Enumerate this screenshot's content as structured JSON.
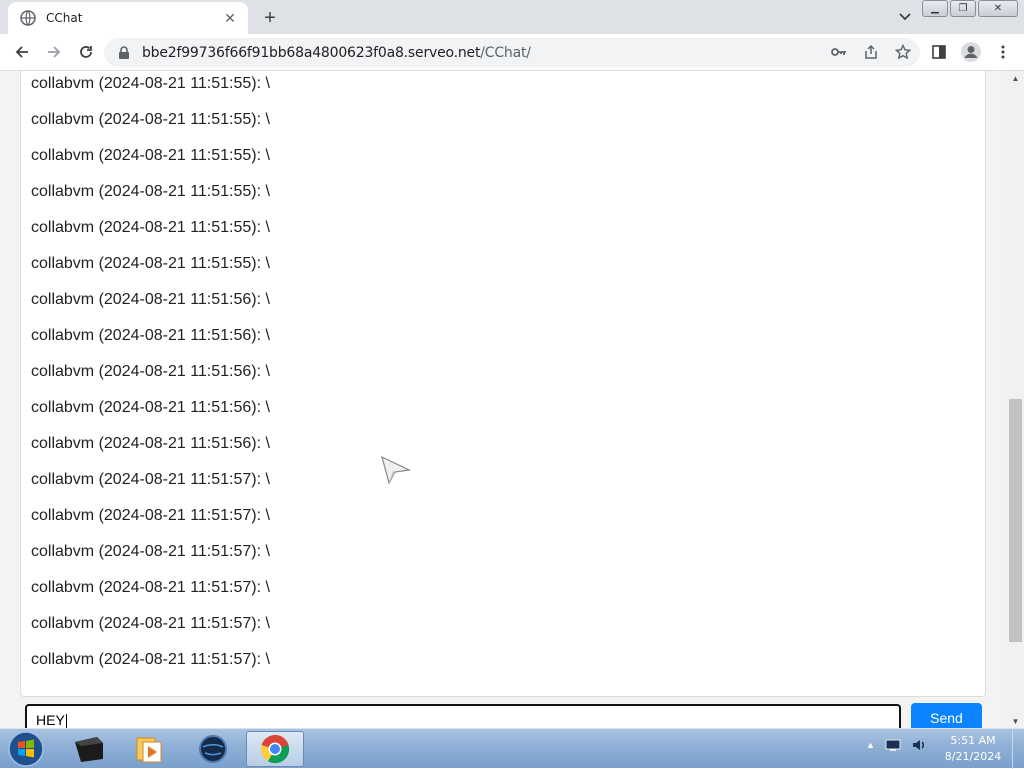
{
  "browser": {
    "tab_title": "CChat",
    "url_host": "bbe2f99736f66f91bb68a4800623f0a8.serveo.net",
    "url_path": "/CChat/"
  },
  "chat": {
    "messages": [
      "collabvm (2024-08-21 11:51:55): \\",
      "collabvm (2024-08-21 11:51:55): \\",
      "collabvm (2024-08-21 11:51:55): \\",
      "collabvm (2024-08-21 11:51:55): \\",
      "collabvm (2024-08-21 11:51:55): \\",
      "collabvm (2024-08-21 11:51:55): \\",
      "collabvm (2024-08-21 11:51:56): \\",
      "collabvm (2024-08-21 11:51:56): \\",
      "collabvm (2024-08-21 11:51:56): \\",
      "collabvm (2024-08-21 11:51:56): \\",
      "collabvm (2024-08-21 11:51:56): \\",
      "collabvm (2024-08-21 11:51:57): \\",
      "collabvm (2024-08-21 11:51:57): \\",
      "collabvm (2024-08-21 11:51:57): \\",
      "collabvm (2024-08-21 11:51:57): \\",
      "collabvm (2024-08-21 11:51:57): \\",
      "collabvm (2024-08-21 11:51:57): \\"
    ],
    "input_value": "HEY",
    "send_label": "Send"
  },
  "taskbar": {
    "time": "5:51 AM",
    "date": "8/21/2024"
  },
  "colors": {
    "send_button": "#0d84ff",
    "taskbar": "#8fb0d6"
  }
}
